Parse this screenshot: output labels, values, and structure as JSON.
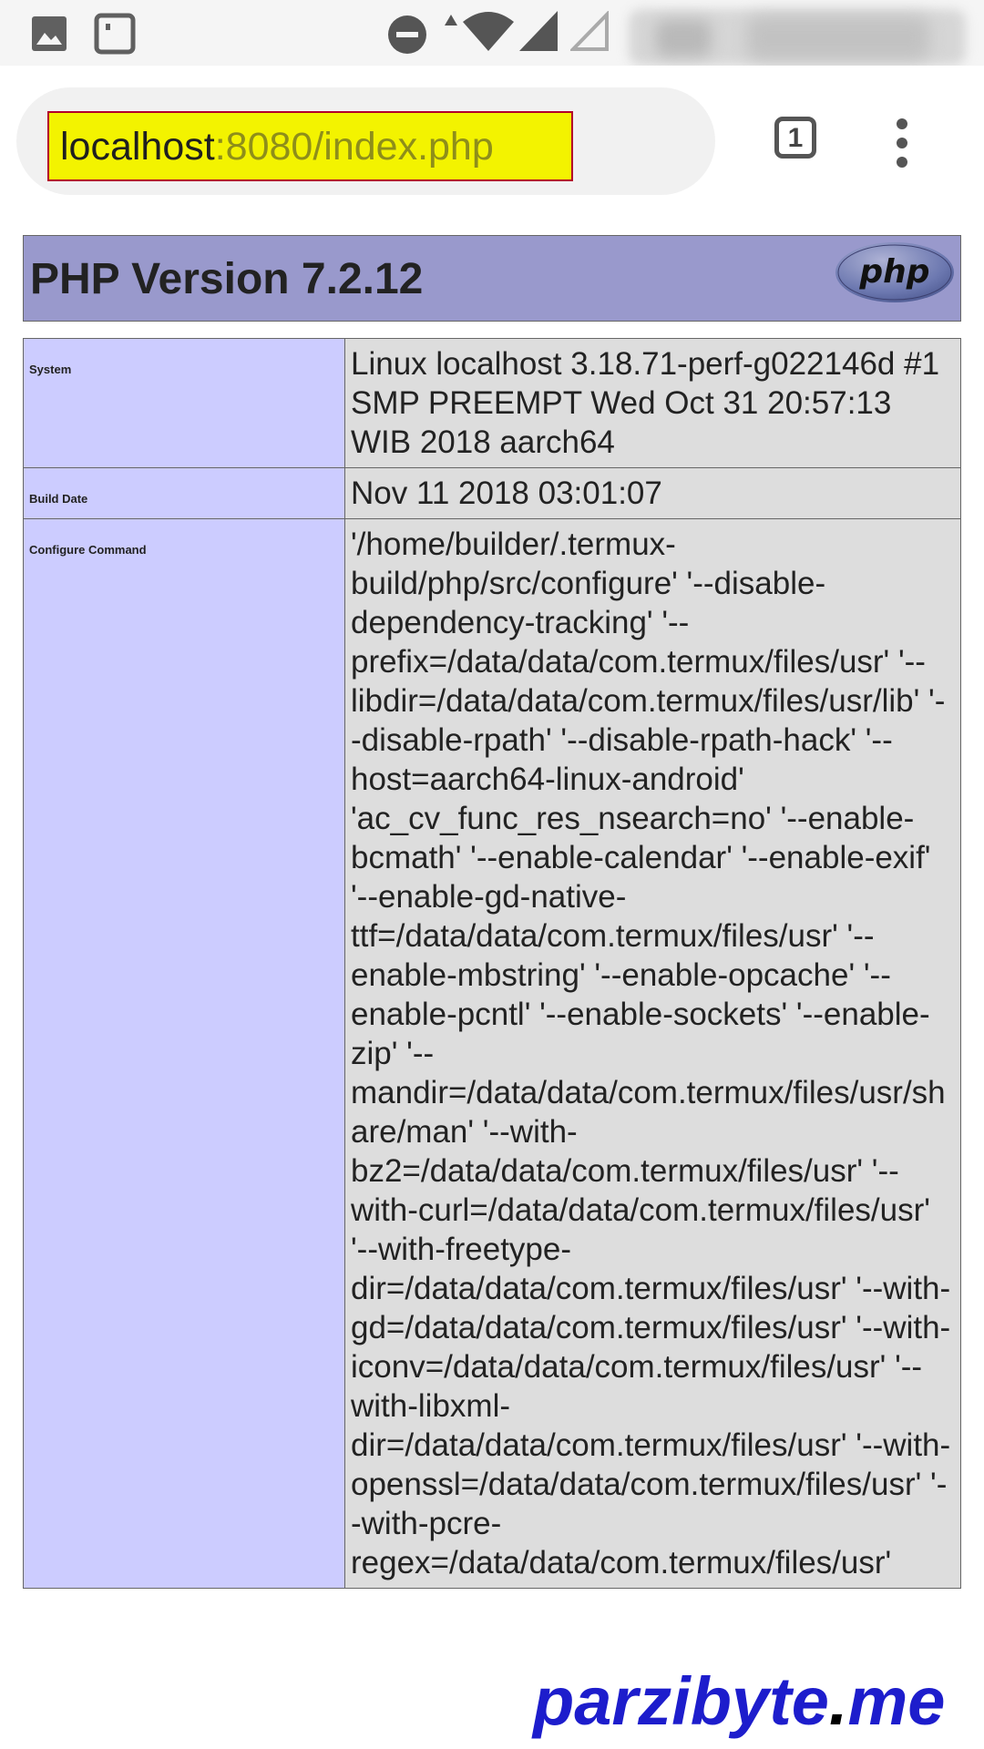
{
  "statusbar": {
    "icons": [
      "image-icon",
      "notification-icon",
      "do-not-disturb-icon",
      "data-arrow-icon",
      "wifi-icon",
      "cellular-signal-icon",
      "cellular-signal-empty-icon"
    ]
  },
  "browser": {
    "url_host": "localhost",
    "url_rest": ":8080/index.php",
    "tab_count": "1"
  },
  "page": {
    "title": "PHP Version 7.2.12",
    "logo_text": "php",
    "rows": [
      {
        "label": "System",
        "value": "Linux localhost 3.18.71-perf-g022146d #1 SMP PREEMPT Wed Oct 31 20:57:13 WIB 2018 aarch64"
      },
      {
        "label": "Build Date",
        "value": "Nov 11 2018 03:01:07"
      },
      {
        "label": "Configure Command",
        "value": "'/home/builder/.termux-build/php/src/configure' '--disable-dependency-tracking' '--prefix=/data/data/com.termux/files/usr' '--libdir=/data/data/com.termux/files/usr/lib' '--disable-rpath' '--disable-rpath-hack' '--host=aarch64-linux-android' 'ac_cv_func_res_nsearch=no' '--enable-bcmath' '--enable-calendar' '--enable-exif' '--enable-gd-native-ttf=/data/data/com.termux/files/usr' '--enable-mbstring' '--enable-opcache' '--enable-pcntl' '--enable-sockets' '--enable-zip' '--mandir=/data/data/com.termux/files/usr/share/man' '--with-bz2=/data/data/com.termux/files/usr' '--with-curl=/data/data/com.termux/files/usr' '--with-freetype-dir=/data/data/com.termux/files/usr' '--with-gd=/data/data/com.termux/files/usr' '--with-iconv=/data/data/com.termux/files/usr' '--with-libxml-dir=/data/data/com.termux/files/usr' '--with-openssl=/data/data/com.termux/files/usr' '--with-pcre-regex=/data/data/com.termux/files/usr'"
      }
    ]
  },
  "watermark": {
    "part1": "parzibyte",
    "dot": ".",
    "part2": "me"
  }
}
